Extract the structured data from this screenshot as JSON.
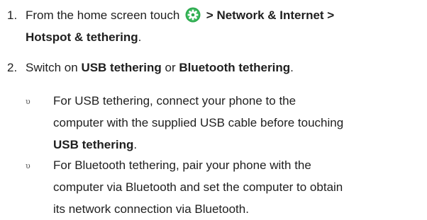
{
  "steps": [
    {
      "number": "1.",
      "text_before_icon": "From the home screen touch",
      "icon": "settings-gear-icon",
      "icon_color": "#2fa84f",
      "path_line1": "> Network & Internet >",
      "path_line2": "Hotspot & tethering",
      "period": "."
    },
    {
      "number": "2.",
      "text1": "Switch on ",
      "bold1": "USB tethering",
      "text2": " or ",
      "bold2": "Bluetooth tethering",
      "text3": "."
    }
  ],
  "bullets": [
    {
      "marker": "υ",
      "line1": "For USB tethering, connect your phone to the",
      "line2": "computer with the supplied USB cable before touching",
      "bold_line3": "USB tethering",
      "period": "."
    },
    {
      "marker": "υ",
      "line1": "For Bluetooth tethering, pair your phone with the",
      "line2": "computer via Bluetooth and set the computer to obtain",
      "line3": "its network connection via Bluetooth."
    }
  ]
}
